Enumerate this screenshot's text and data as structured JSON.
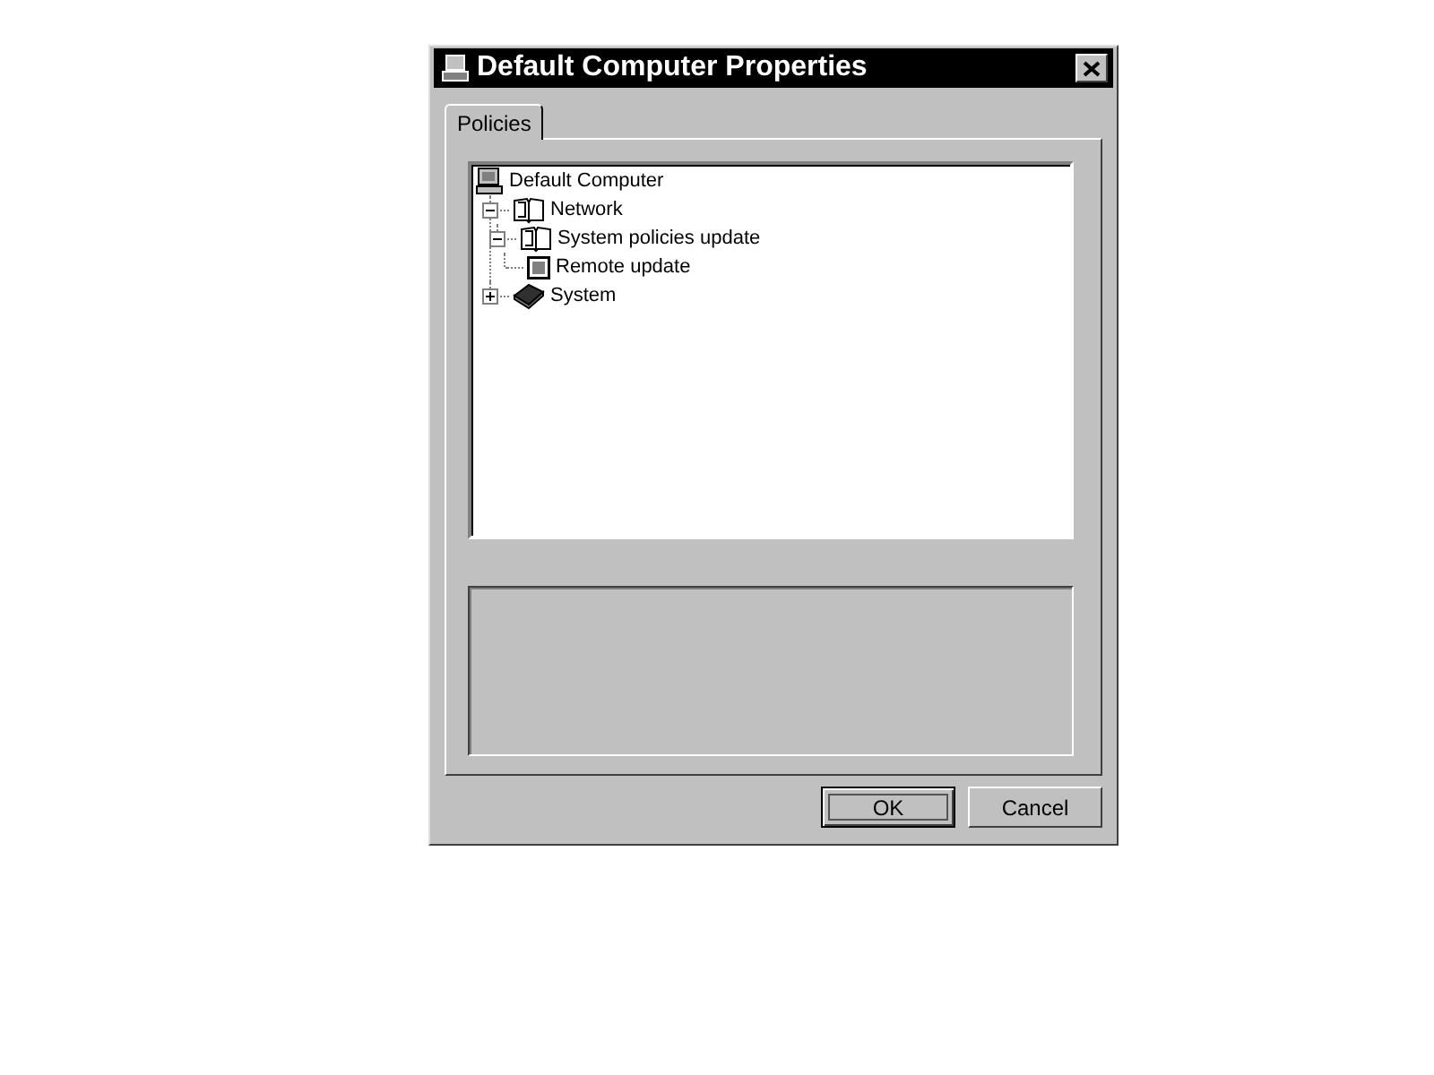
{
  "window": {
    "title": "Default Computer Properties"
  },
  "tabs": [
    {
      "label": "Policies",
      "selected": true
    }
  ],
  "tree": [
    {
      "label": "Default Computer",
      "kind": "computer",
      "children": [
        {
          "label": "Network",
          "kind": "book-open",
          "expanded": true,
          "children": [
            {
              "label": "System policies update",
              "kind": "book-open",
              "expanded": true,
              "children": [
                {
                  "label": "Remote update",
                  "kind": "policy"
                }
              ]
            }
          ]
        },
        {
          "label": "System",
          "kind": "book-closed",
          "expanded": false
        }
      ]
    }
  ],
  "buttons": [
    {
      "label": "OK",
      "default": true
    },
    {
      "label": "Cancel",
      "default": false
    }
  ]
}
